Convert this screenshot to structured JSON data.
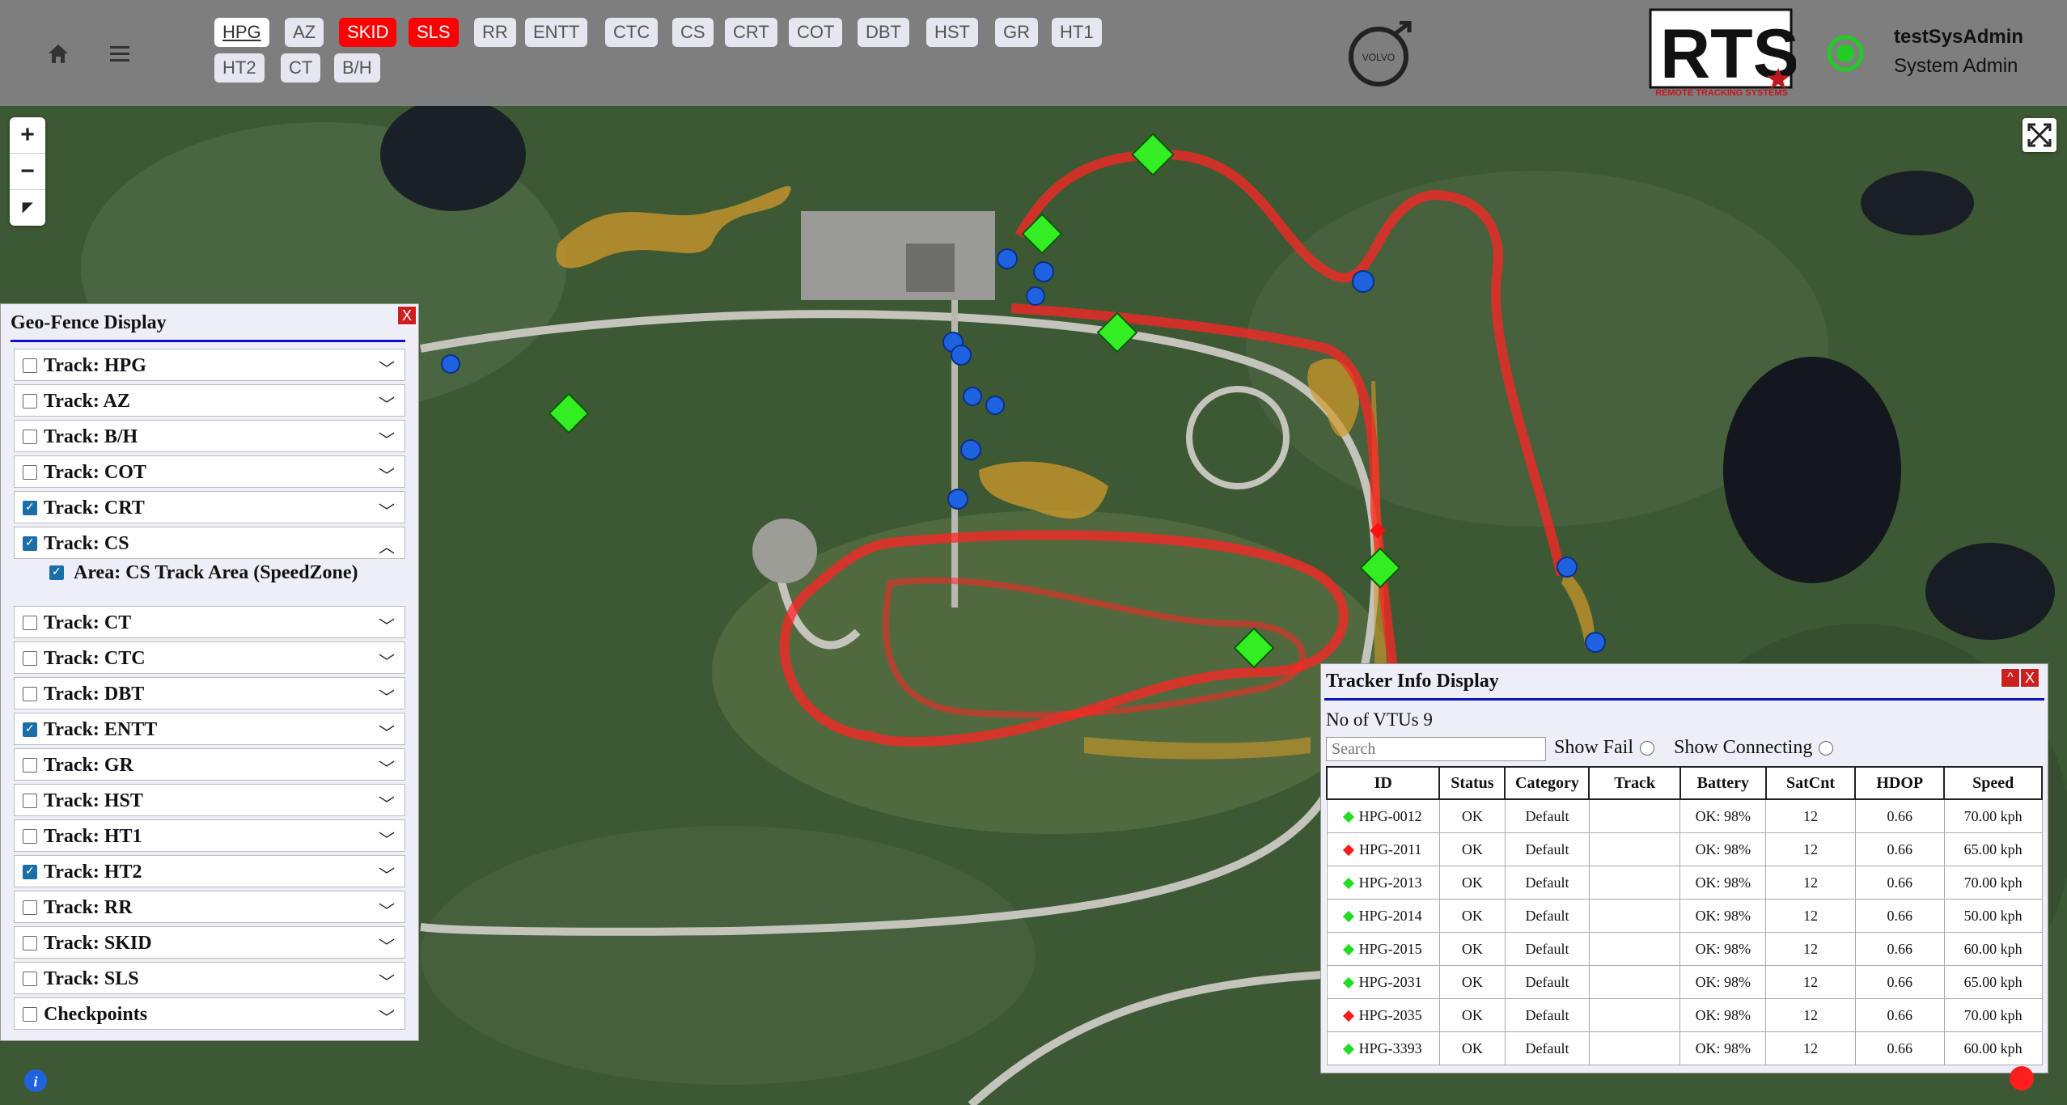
{
  "header": {
    "track_tabs": [
      {
        "label": "HPG",
        "state": "selected"
      },
      {
        "label": "AZ",
        "state": "normal"
      },
      {
        "label": "SKID",
        "state": "alert"
      },
      {
        "label": "SLS",
        "state": "alert"
      },
      {
        "label": "RR",
        "state": "normal"
      },
      {
        "label": "ENTT",
        "state": "normal"
      },
      {
        "label": "CTC",
        "state": "normal"
      },
      {
        "label": "CS",
        "state": "normal"
      },
      {
        "label": "CRT",
        "state": "normal"
      },
      {
        "label": "COT",
        "state": "normal"
      },
      {
        "label": "DBT",
        "state": "normal"
      },
      {
        "label": "HST",
        "state": "normal"
      },
      {
        "label": "GR",
        "state": "normal"
      },
      {
        "label": "HT1",
        "state": "normal"
      },
      {
        "label": "HT2",
        "state": "normal"
      },
      {
        "label": "CT",
        "state": "normal"
      },
      {
        "label": "B/H",
        "state": "normal"
      }
    ],
    "brand": {
      "volvo": "VOLVO",
      "rts_big": "RTS",
      "rts_small": "REMOTE TRACKING SYSTEMS"
    },
    "user": {
      "name": "testSysAdmin",
      "role": "System Admin"
    },
    "colors": {
      "bar": "#7e7e7e",
      "alert": "#ff0000",
      "status": "#22cc22"
    }
  },
  "map_controls": {
    "zoom_in": "+",
    "zoom_out": "−",
    "reset": "◤"
  },
  "geo_fence": {
    "title": "Geo-Fence Display",
    "close": "X",
    "rows": [
      {
        "label": "Track: HPG",
        "checked": false
      },
      {
        "label": "Track: AZ",
        "checked": false
      },
      {
        "label": "Track: B/H",
        "checked": false
      },
      {
        "label": "Track: COT",
        "checked": false
      },
      {
        "label": "Track: CRT",
        "checked": true
      },
      {
        "label": "Track: CS",
        "checked": true,
        "expanded": true
      },
      {
        "label": "Track: CT",
        "checked": false
      },
      {
        "label": "Track: CTC",
        "checked": false
      },
      {
        "label": "Track: DBT",
        "checked": false
      },
      {
        "label": "Track: ENTT",
        "checked": true
      },
      {
        "label": "Track: GR",
        "checked": false
      },
      {
        "label": "Track: HST",
        "checked": false
      },
      {
        "label": "Track: HT1",
        "checked": false
      },
      {
        "label": "Track: HT2",
        "checked": true
      },
      {
        "label": "Track: RR",
        "checked": false
      },
      {
        "label": "Track: SKID",
        "checked": false
      },
      {
        "label": "Track: SLS",
        "checked": false
      },
      {
        "label": "Checkpoints",
        "checked": false
      }
    ],
    "sub_item": {
      "label": "Area: CS Track Area (SpeedZone)",
      "checked": true
    }
  },
  "tracker": {
    "title": "Tracker Info Display",
    "minimize": "^",
    "close": "X",
    "count_text": "No of VTUs 9",
    "search_placeholder": "Search",
    "show_fail": "Show Fail",
    "show_connecting": "Show Connecting",
    "columns": [
      "ID",
      "Status",
      "Category",
      "Track",
      "Battery",
      "SatCnt",
      "HDOP",
      "Speed"
    ],
    "rows": [
      {
        "id": "HPG-0012",
        "marker": "green",
        "status": "OK",
        "category": "Default",
        "track": "",
        "battery": "OK: 98%",
        "satcnt": "12",
        "hdop": "0.66",
        "speed": "70.00 kph"
      },
      {
        "id": "HPG-2011",
        "marker": "red",
        "status": "OK",
        "category": "Default",
        "track": "",
        "battery": "OK: 98%",
        "satcnt": "12",
        "hdop": "0.66",
        "speed": "65.00 kph"
      },
      {
        "id": "HPG-2013",
        "marker": "green",
        "status": "OK",
        "category": "Default",
        "track": "",
        "battery": "OK: 98%",
        "satcnt": "12",
        "hdop": "0.66",
        "speed": "70.00 kph"
      },
      {
        "id": "HPG-2014",
        "marker": "green",
        "status": "OK",
        "category": "Default",
        "track": "",
        "battery": "OK: 98%",
        "satcnt": "12",
        "hdop": "0.66",
        "speed": "50.00 kph"
      },
      {
        "id": "HPG-2015",
        "marker": "green",
        "status": "OK",
        "category": "Default",
        "track": "",
        "battery": "OK: 98%",
        "satcnt": "12",
        "hdop": "0.66",
        "speed": "60.00 kph"
      },
      {
        "id": "HPG-2031",
        "marker": "green",
        "status": "OK",
        "category": "Default",
        "track": "",
        "battery": "OK: 98%",
        "satcnt": "12",
        "hdop": "0.66",
        "speed": "65.00 kph"
      },
      {
        "id": "HPG-2035",
        "marker": "red",
        "status": "OK",
        "category": "Default",
        "track": "",
        "battery": "OK: 98%",
        "satcnt": "12",
        "hdop": "0.66",
        "speed": "70.00 kph"
      },
      {
        "id": "HPG-3393",
        "marker": "green",
        "status": "OK",
        "category": "Default",
        "track": "",
        "battery": "OK: 98%",
        "satcnt": "12",
        "hdop": "0.66",
        "speed": "60.00 kph"
      }
    ]
  },
  "info_icon": "i"
}
